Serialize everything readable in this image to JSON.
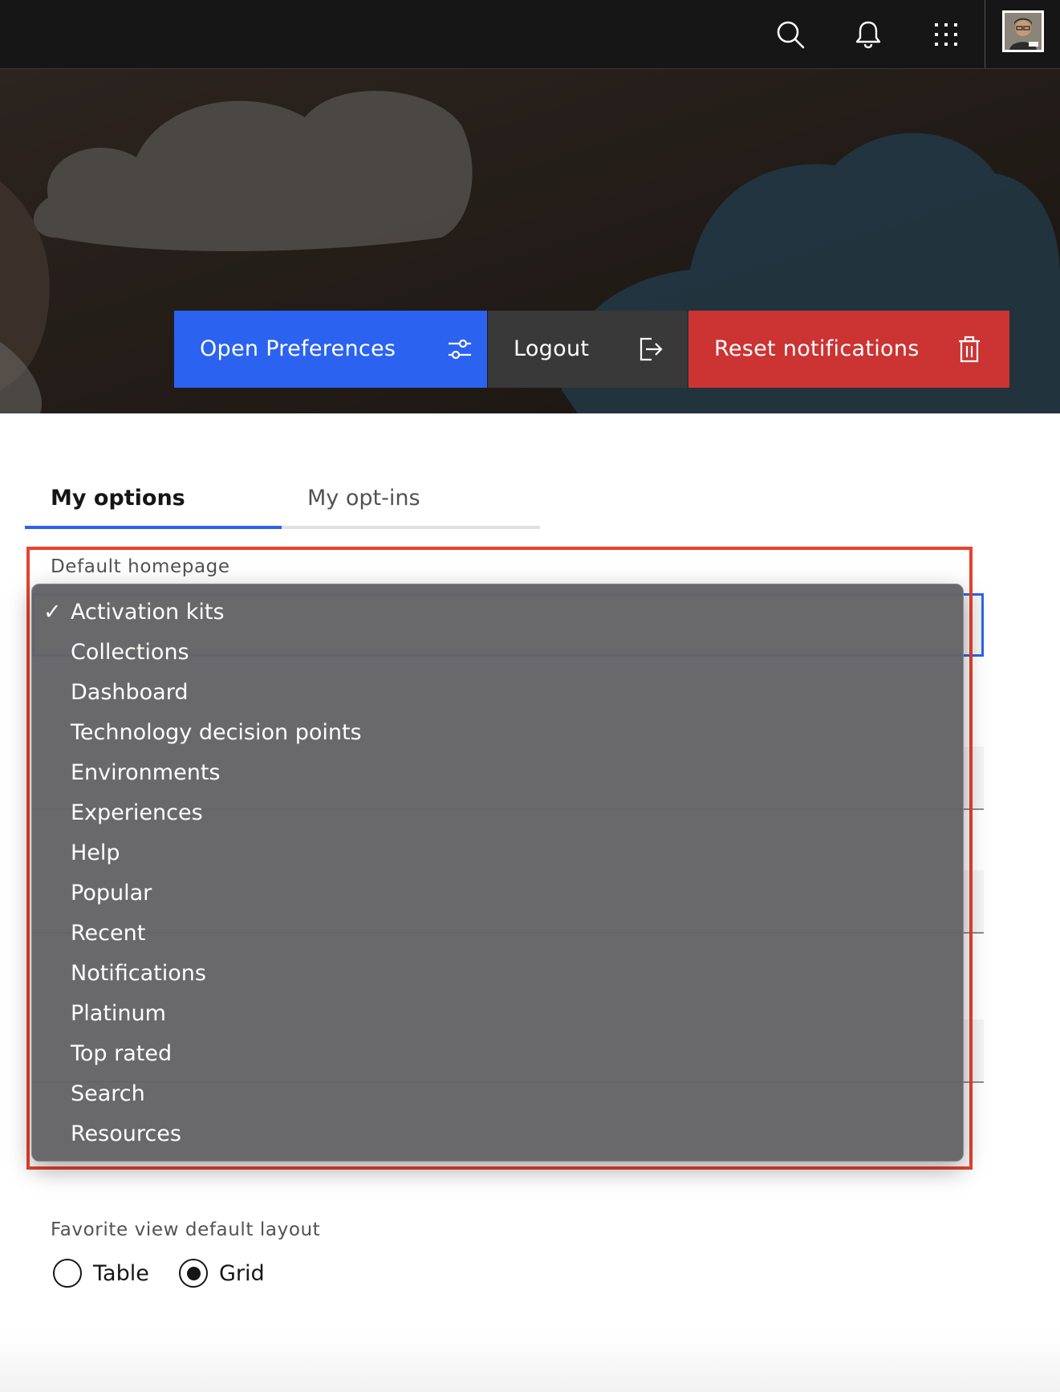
{
  "header": {
    "icons": [
      "search-icon",
      "notification-bell-icon",
      "app-switcher-icon",
      "user-avatar"
    ]
  },
  "hero": {
    "actions": [
      {
        "label": "Open Preferences",
        "icon": "sliders-icon",
        "color": "#2b63f0"
      },
      {
        "label": "Logout",
        "icon": "logout-icon",
        "color": "#393939"
      },
      {
        "label": "Reset notifications",
        "icon": "trash-icon",
        "color": "#cc3333"
      }
    ]
  },
  "tabs": [
    {
      "label": "My options",
      "selected": true
    },
    {
      "label": "My opt-ins",
      "selected": false
    }
  ],
  "form": {
    "homepage_label": "Default homepage",
    "homepage_options": [
      "Activation kits",
      "Collections",
      "Dashboard",
      "Technology decision points",
      "Environments",
      "Experiences",
      "Help",
      "Popular",
      "Recent",
      "Notifications",
      "Platinum",
      "Top rated",
      "Search",
      "Resources"
    ],
    "homepage_selected": "Activation kits",
    "check_mark": "✓",
    "layout_label": "Favorite view default layout",
    "layout_options": [
      {
        "label": "Table",
        "checked": false
      },
      {
        "label": "Grid",
        "checked": true
      }
    ]
  },
  "colors": {
    "accent": "#2b63f0",
    "danger": "#cc3333",
    "highlight": "#e8432e",
    "header_bg": "#161616"
  }
}
